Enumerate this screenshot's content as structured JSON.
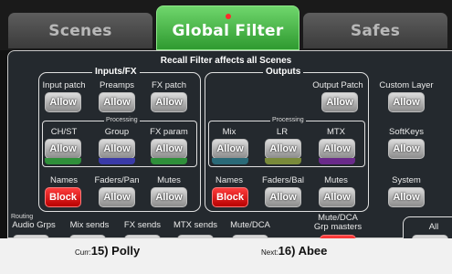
{
  "tabs": [
    "Scenes",
    "Global Filter",
    "Safes"
  ],
  "banner": "Recall Filter affects all Scenes",
  "groups": {
    "inputs": "Inputs/FX",
    "outputs": "Outputs",
    "processing": "Processing",
    "routing": "Routing"
  },
  "labels": {
    "input_patch": "Input patch",
    "preamps": "Preamps",
    "fx_patch": "FX patch",
    "output_patch": "Output Patch",
    "custom_layer": "Custom Layer",
    "ch_st": "CH/ST",
    "group": "Group",
    "fx_param": "FX param",
    "mix": "Mix",
    "lr": "LR",
    "mtx": "MTX",
    "softkeys": "SoftKeys",
    "names_in": "Names",
    "faders_pan": "Faders/Pan",
    "mutes_in": "Mutes",
    "names_out": "Names",
    "faders_bal": "Faders/Bal",
    "mutes_out": "Mutes",
    "system": "System",
    "audio_grps": "Audio Grps",
    "mix_sends": "Mix sends",
    "fx_sends": "FX sends",
    "mtx_sends": "MTX sends",
    "mute_dca": "Mute/DCA",
    "mute_dca_grp_masters": "Mute/DCA\nGrp masters",
    "all": "All"
  },
  "buttons": {
    "allow": "Allow",
    "block": "Block"
  },
  "status": {
    "curr_label": "Curr:",
    "curr_value": "15) Polly",
    "next_label": "Next:",
    "next_value": "16) Abee"
  },
  "colors": {
    "active_tab": "#3fb83d",
    "block": "#e00000",
    "allow": "#b0b0b0",
    "background": "#24292e"
  }
}
